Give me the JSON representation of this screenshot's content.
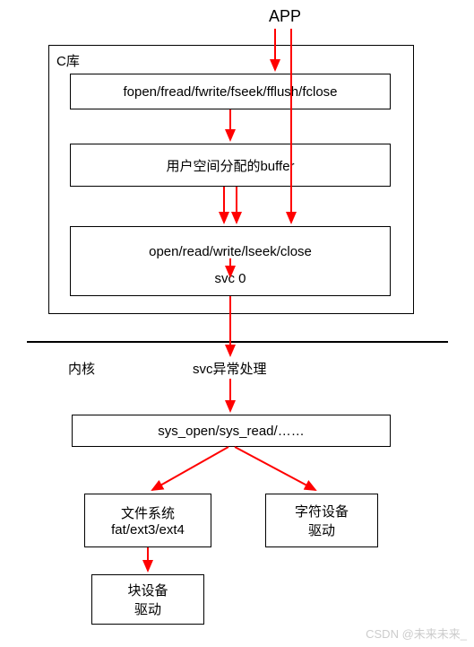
{
  "top_label": "APP",
  "clib_label": "C库",
  "clib_box1": "fopen/fread/fwrite/fseek/fflush/fclose",
  "clib_box2": "用户空间分配的buffer",
  "clib_box3_line1": "open/read/write/lseek/close",
  "clib_box3_line2": "svc 0",
  "kernel_label": "内核",
  "svc_handler": "svc异常处理",
  "syscall_box": "sys_open/sys_read/……",
  "fs_line1": "文件系统",
  "fs_line2": "fat/ext3/ext4",
  "chardev_line1": "字符设备",
  "chardev_line2": "驱动",
  "blockdev_line1": "块设备",
  "blockdev_line2": "驱动",
  "watermark": "CSDN @未来未来_",
  "colors": {
    "arrow": "#ff0000"
  }
}
